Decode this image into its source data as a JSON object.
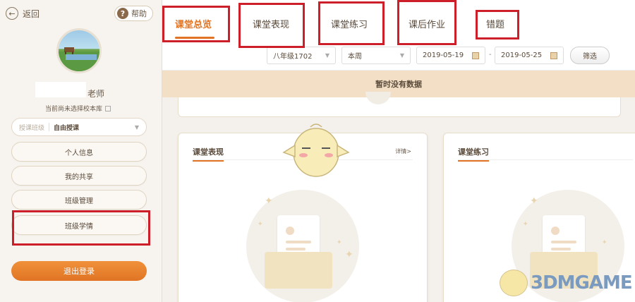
{
  "sidebar": {
    "back_label": "返回",
    "help_label": "帮助",
    "teacher_suffix": "老师",
    "school_notice": "当前尚未选择校本库",
    "class_select": {
      "placeholder": "授课班级",
      "value": "自由授课"
    },
    "menu": [
      {
        "label": "个人信息"
      },
      {
        "label": "我的共享"
      },
      {
        "label": "班级管理"
      },
      {
        "label": "班级学情"
      }
    ],
    "logout_label": "退出登录"
  },
  "tabs": [
    {
      "label": "课堂总览",
      "active": true
    },
    {
      "label": "课堂表现",
      "active": false
    },
    {
      "label": "课堂练习",
      "active": false
    },
    {
      "label": "课后作业",
      "active": false
    },
    {
      "label": "错题",
      "active": false
    }
  ],
  "filters": {
    "grade": "八年级1702",
    "period": "本周",
    "start_date": "2019-05-19",
    "end_date": "2019-05-25",
    "button_label": "筛选"
  },
  "banner_text": "暂时没有数据",
  "cards": [
    {
      "title": "课堂表现",
      "detail_link": "详情>"
    },
    {
      "title": "课堂练习",
      "detail_link": ""
    }
  ],
  "watermark_text": "3DMGAME",
  "colors": {
    "accent": "#e07424",
    "highlight_red": "#cc1f2a",
    "banner": "#f2dfc5"
  }
}
